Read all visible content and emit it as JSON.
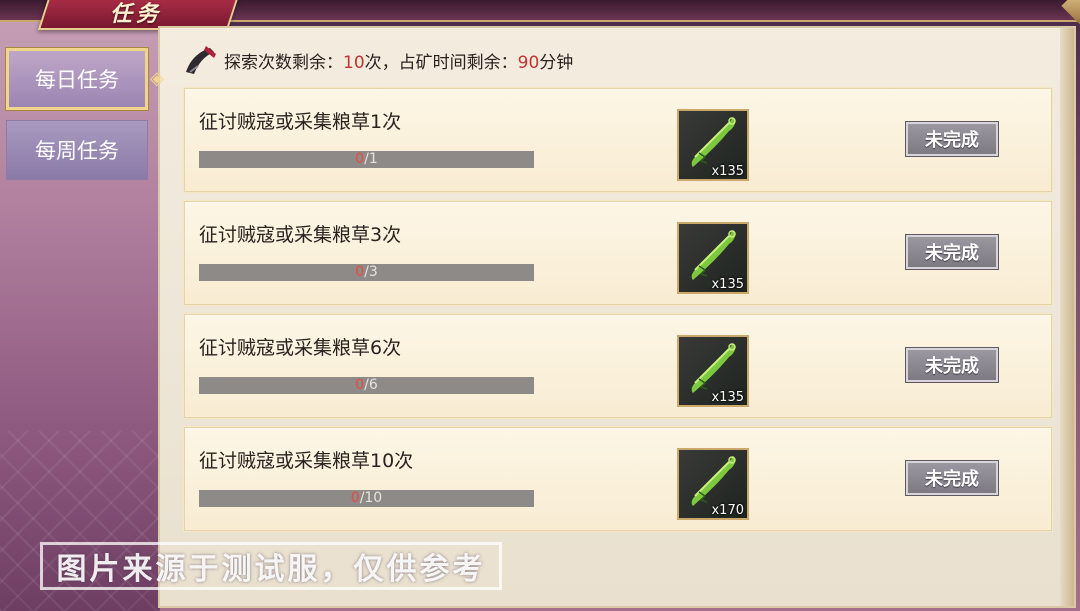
{
  "header": {
    "title": "任务"
  },
  "tabs": [
    {
      "label": "每日任务",
      "active": true
    },
    {
      "label": "每周任务",
      "active": false
    }
  ],
  "info": {
    "prefix": "探索次数剩余：",
    "explore_count": "10",
    "explore_unit": "次，占矿时间剩余：",
    "mine_minutes": "90",
    "mine_unit": "分钟"
  },
  "tasks": [
    {
      "title": "征讨贼寇或采集粮草1次",
      "progress_current": "0",
      "progress_total": "/1",
      "reward_icon": "green-blade-icon",
      "reward_count": "x135",
      "status": "未完成"
    },
    {
      "title": "征讨贼寇或采集粮草3次",
      "progress_current": "0",
      "progress_total": "/3",
      "reward_icon": "green-blade-icon",
      "reward_count": "x135",
      "status": "未完成"
    },
    {
      "title": "征讨贼寇或采集粮草6次",
      "progress_current": "0",
      "progress_total": "/6",
      "reward_icon": "green-blade-icon",
      "reward_count": "x135",
      "status": "未完成"
    },
    {
      "title": "征讨贼寇或采集粮草10次",
      "progress_current": "0",
      "progress_total": "/10",
      "reward_icon": "green-blade-icon",
      "reward_count": "x170",
      "status": "未完成"
    }
  ],
  "watermark": "图片来源于测试服，仅供参考",
  "colors": {
    "accent_red": "#c0352e",
    "gold_border": "#c9a86a",
    "parchment": "#fdf6e6"
  }
}
